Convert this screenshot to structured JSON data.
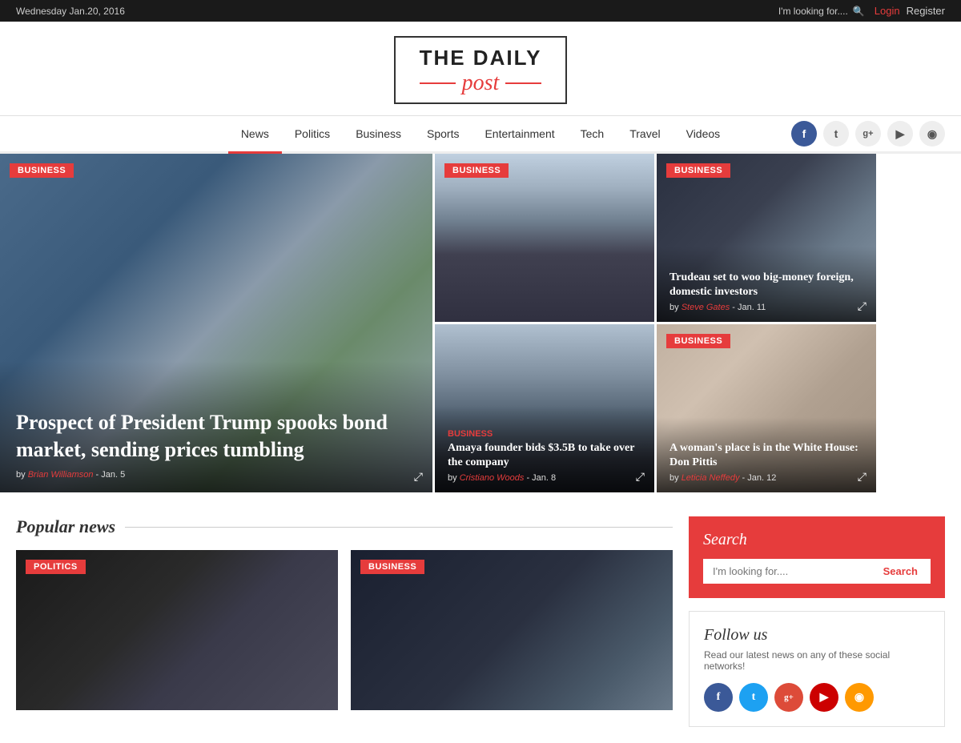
{
  "topbar": {
    "date": "Wednesday Jan.20, 2016",
    "search_placeholder": "I'm looking for....",
    "login_label": "Login",
    "register_label": "Register"
  },
  "logo": {
    "line1": "THE DAILY",
    "line2": "post"
  },
  "nav": {
    "items": [
      {
        "label": "News",
        "active": true
      },
      {
        "label": "Politics"
      },
      {
        "label": "Business"
      },
      {
        "label": "Sports"
      },
      {
        "label": "Entertainment"
      },
      {
        "label": "Tech"
      },
      {
        "label": "Travel"
      },
      {
        "label": "Videos"
      }
    ]
  },
  "hero": {
    "main": {
      "category": "Business",
      "title": "Prospect of President Trump spooks bond market, sending prices tumbling",
      "author": "Brian Williamson",
      "date": "Jan. 5"
    },
    "mid_top": {
      "category": "Business"
    },
    "mid_bottom": {
      "category": "Business",
      "cat_label": "Business",
      "title": "Amaya founder bids $3.5B to take over the company",
      "author": "Cristiano Woods",
      "date": "Jan. 8"
    },
    "right_top": {
      "category": "Business",
      "title": "Trudeau set to woo big-money foreign, domestic investors",
      "author": "Steve Gates",
      "date": "Jan. 11"
    },
    "right_bottom": {
      "category": "Business",
      "title": "A woman's place is in the White House: Don Pittis",
      "author": "Leticia Neffedy",
      "date": "Jan. 12"
    }
  },
  "popular_news": {
    "section_title": "Popular news",
    "items": [
      {
        "category": "Politics",
        "image_type": "politics"
      },
      {
        "category": "Business",
        "image_type": "business"
      }
    ]
  },
  "sidebar": {
    "search": {
      "title": "Search",
      "placeholder": "I'm looking for....",
      "button_label": "Search"
    },
    "follow": {
      "title": "Follow us",
      "description": "Read our latest news on any of these social networks!"
    }
  },
  "icons": {
    "facebook": "f",
    "twitter": "t",
    "googleplus": "g+",
    "youtube": "▶",
    "rss": "◉",
    "share": "⤢"
  }
}
